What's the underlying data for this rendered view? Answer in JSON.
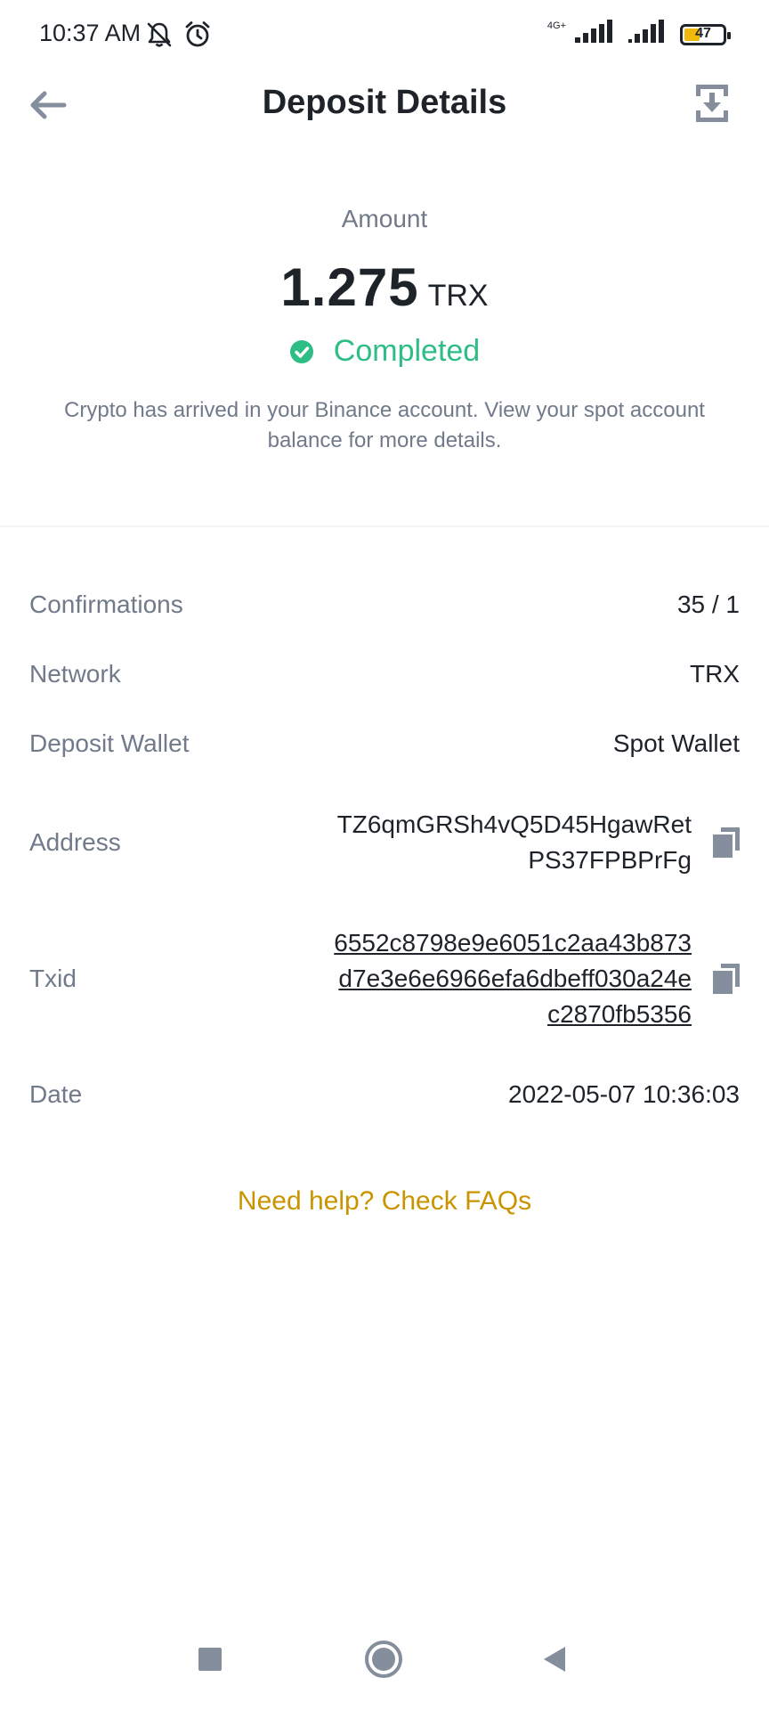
{
  "status_bar": {
    "time": "10:37 AM",
    "network": "4G+",
    "battery": "47",
    "battery_level": 0.47
  },
  "header": {
    "title": "Deposit Details",
    "back_icon": "arrow-left-icon",
    "share_icon": "download-share-icon"
  },
  "amount": {
    "label": "Amount",
    "value": "1.275",
    "unit": "TRX",
    "status": "Completed",
    "status_color": "#2ebd85",
    "note": "Crypto has arrived in your Binance account. View your spot account balance for more details."
  },
  "details": {
    "confirmations": {
      "label": "Confirmations",
      "value": "35 / 1"
    },
    "network": {
      "label": "Network",
      "value": "TRX"
    },
    "wallet": {
      "label": "Deposit Wallet",
      "value": "Spot Wallet"
    },
    "address": {
      "label": "Address",
      "value": "TZ6qmGRSh4vQ5D45HgawRet\nPS37FPBPrFg"
    },
    "txid": {
      "label": "Txid",
      "value": "6552c8798e9e6051c2aa43b873\nd7e3e6e6966efa6dbeff030a24e\nc2870fb5356"
    },
    "date": {
      "label": "Date",
      "value": "2022-05-07 10:36:03"
    }
  },
  "help": {
    "label": "Need help? Check FAQs",
    "color": "#c99400"
  },
  "colors": {
    "text_primary": "#1e2329",
    "text_secondary": "#707a8a",
    "icon_gray": "#848e9c"
  }
}
